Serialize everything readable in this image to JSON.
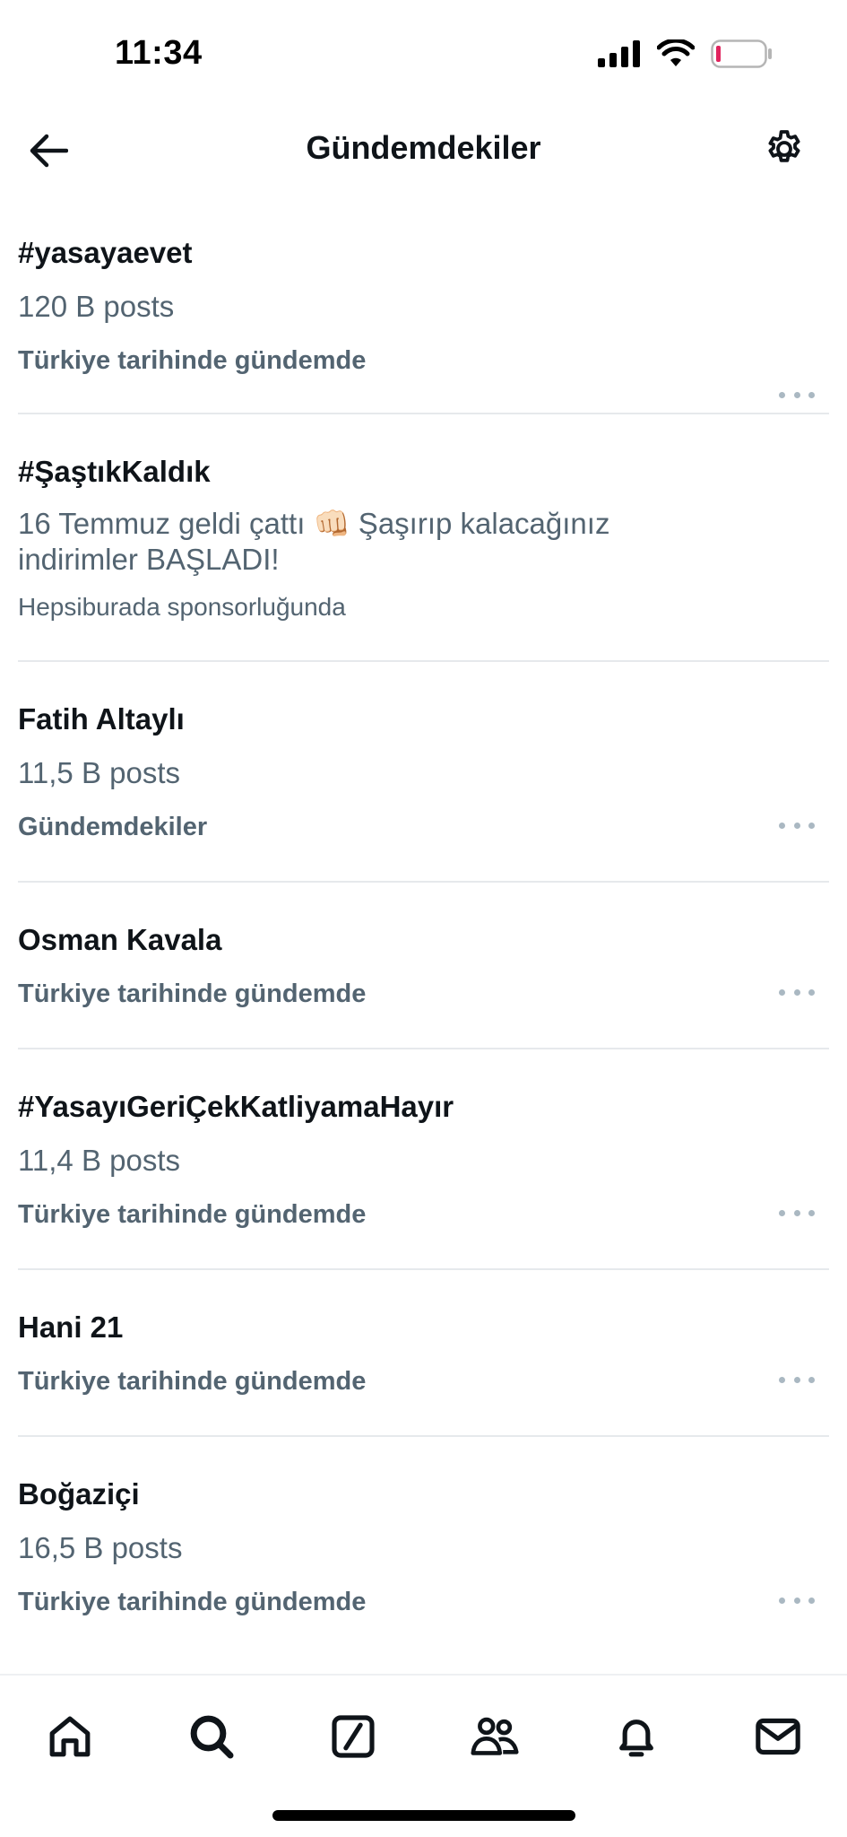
{
  "status_bar": {
    "time": "11:34"
  },
  "header": {
    "title": "Gündemdekiler"
  },
  "trends": [
    {
      "name": "#yasayaevet",
      "count": "120 B posts",
      "context": "Türkiye tarihinde gündemde"
    },
    {
      "name": "#ŞaştıkKaldık",
      "desc_line1": "16 Temmuz geldi çattı 👊🏻 Şaşırıp kalacağınız",
      "desc_line2": "indirimler BAŞLADI!",
      "sponsor": "Hepsiburada sponsorluğunda"
    },
    {
      "name": "Fatih Altaylı",
      "count": "11,5 B posts",
      "context": "Gündemdekiler"
    },
    {
      "name": "Osman Kavala",
      "context": "Türkiye tarihinde gündemde"
    },
    {
      "name": "#YasayıGeriÇekKatliyamaHayır",
      "count": "11,4 B posts",
      "context": "Türkiye tarihinde gündemde"
    },
    {
      "name": "Hani 21",
      "context": "Türkiye tarihinde gündemde"
    },
    {
      "name": "Boğaziçi",
      "count": "16,5 B posts",
      "context": "Türkiye tarihinde gündemde"
    }
  ],
  "icons": {
    "back": "arrow-left-icon",
    "settings": "gear-icon",
    "more": "more-horizontal-icon",
    "tabs": [
      "home-icon",
      "search-icon",
      "compose-icon",
      "communities-icon",
      "notifications-icon",
      "messages-icon"
    ]
  },
  "colors": {
    "text": "#0f1419",
    "secondary": "#536471",
    "divider": "#e6e9ec",
    "battery_low": "#e0245e"
  }
}
